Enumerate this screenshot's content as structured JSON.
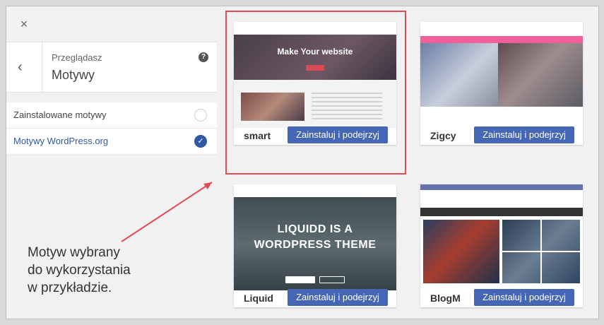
{
  "header": {
    "close_icon": "×",
    "back_icon": "‹",
    "breadcrumb": "Przeglądasz",
    "title": "Motywy",
    "help_icon": "?"
  },
  "sources": [
    {
      "label": "Zainstalowane motywy",
      "selected": false
    },
    {
      "label": "Motywy WordPress.org",
      "selected": true
    }
  ],
  "annotation": {
    "lines": [
      "Motyw wybrany",
      "do wykorzystania",
      "w przykładzie."
    ]
  },
  "themes": [
    {
      "name": "smart",
      "button": "Zainstaluj i podejrzyj",
      "preview_text": "Make Your website"
    },
    {
      "name": "Zigcy",
      "button": "Zainstaluj i podejrzyj"
    },
    {
      "name": "Liquid",
      "button": "Zainstaluj i podejrzyj",
      "preview_text": [
        "LIQUIDD IS A",
        "WORDPRESS THEME"
      ]
    },
    {
      "name": "BlogM",
      "button": "Zainstaluj i podejrzyj"
    }
  ],
  "colors": {
    "selection_border": "#e04b55",
    "button": "#4566b4",
    "active_radio": "#2f5aa3"
  }
}
